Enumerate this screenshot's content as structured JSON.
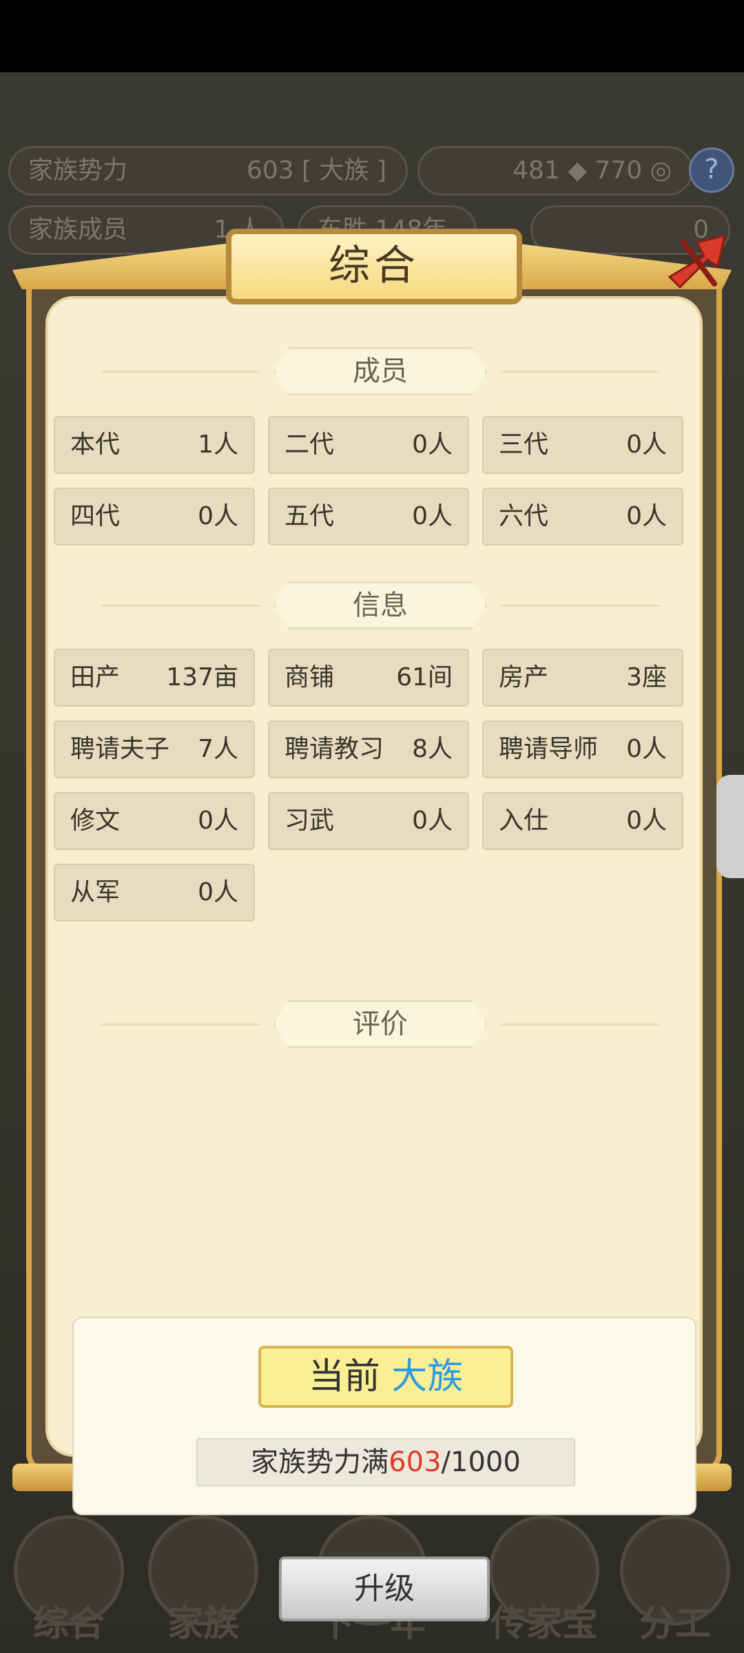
{
  "background": {
    "power_label": "家族势力",
    "power_value": "603 [ 大族 ]",
    "resources": "481 ◆ 770 ◎",
    "members_label": "家族成员",
    "members_value": "1 人",
    "age_text": "东胜 148年",
    "gold_value": "0"
  },
  "bottom_nav": [
    {
      "label": "综合"
    },
    {
      "label": "家族"
    },
    {
      "label": "下一年"
    },
    {
      "label": "传家宝"
    },
    {
      "label": "分工"
    }
  ],
  "dialog": {
    "title": "综合",
    "section_members": "成员",
    "members": [
      {
        "label": "本代",
        "value": "1人"
      },
      {
        "label": "二代",
        "value": "0人"
      },
      {
        "label": "三代",
        "value": "0人"
      },
      {
        "label": "四代",
        "value": "0人"
      },
      {
        "label": "五代",
        "value": "0人"
      },
      {
        "label": "六代",
        "value": "0人"
      }
    ],
    "section_info": "信息",
    "info": [
      {
        "label": "田产",
        "value": "137亩"
      },
      {
        "label": "商铺",
        "value": "61间"
      },
      {
        "label": "房产",
        "value": "3座"
      },
      {
        "label": "聘请夫子",
        "value": "7人"
      },
      {
        "label": "聘请教习",
        "value": "8人"
      },
      {
        "label": "聘请导师",
        "value": "0人"
      },
      {
        "label": "修文",
        "value": "0人"
      },
      {
        "label": "习武",
        "value": "0人"
      },
      {
        "label": "入仕",
        "value": "0人"
      },
      {
        "label": "从军",
        "value": "0人"
      }
    ],
    "section_eval": "评价",
    "rank_prefix": "当前",
    "rank_name": "大族",
    "power_prefix": "家族势力满",
    "power_current": "603",
    "power_max": "/1000",
    "upgrade_label": "升级"
  },
  "colors": {
    "dialog_bg": "#f7efcf",
    "cell_bg": "#e7dcbf",
    "rank_name": "#2d9ae2",
    "power_current": "#e23b28",
    "gold_frame": "#d8a64a",
    "close_icon": "#d93a2c"
  }
}
